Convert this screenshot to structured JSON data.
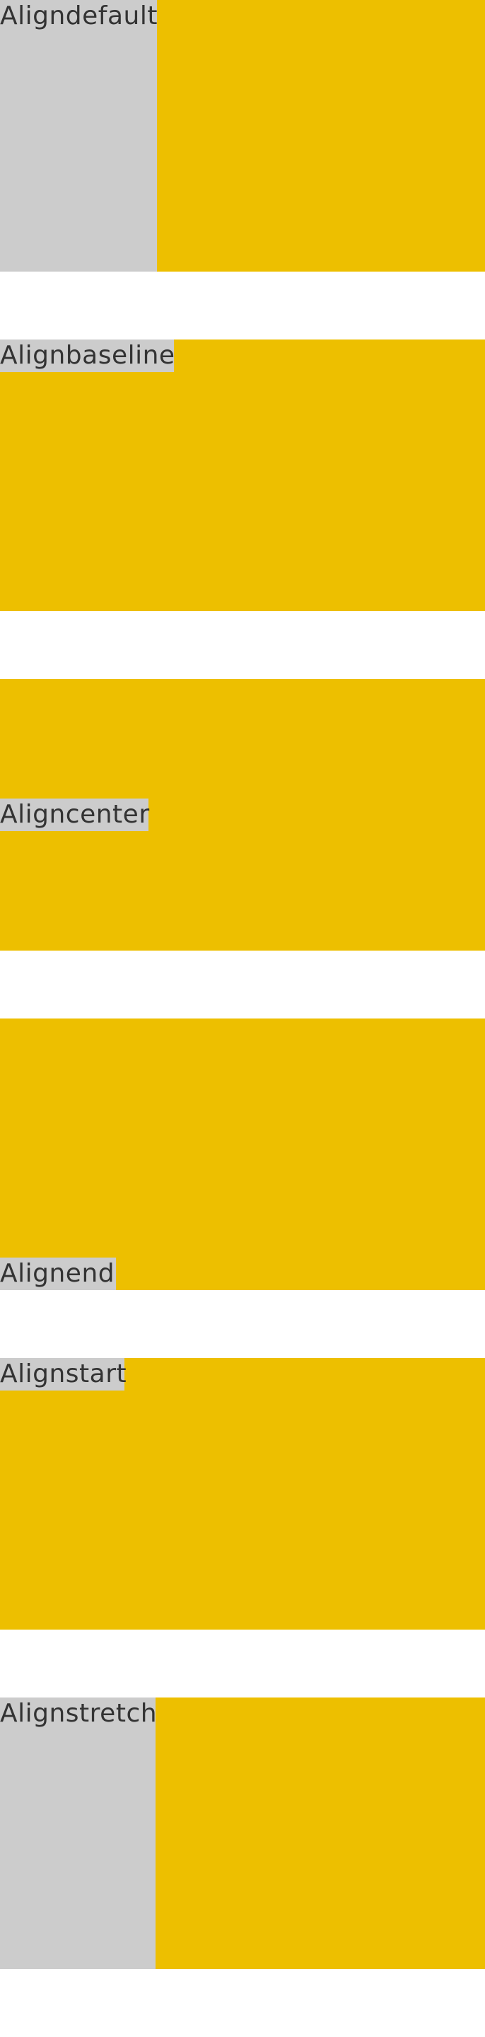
{
  "colors": {
    "yellow": "#edbf00",
    "label_bg": "#cccccc",
    "text": "#333333",
    "page_bg": "#ffffff"
  },
  "blocks": [
    {
      "id": "default",
      "label": "Aligndefault"
    },
    {
      "id": "baseline",
      "label": "Alignbaseline"
    },
    {
      "id": "center",
      "label": "Aligncenter"
    },
    {
      "id": "end",
      "label": "Alignend"
    },
    {
      "id": "start",
      "label": "Alignstart"
    },
    {
      "id": "stretch",
      "label": "Alignstretch"
    }
  ]
}
